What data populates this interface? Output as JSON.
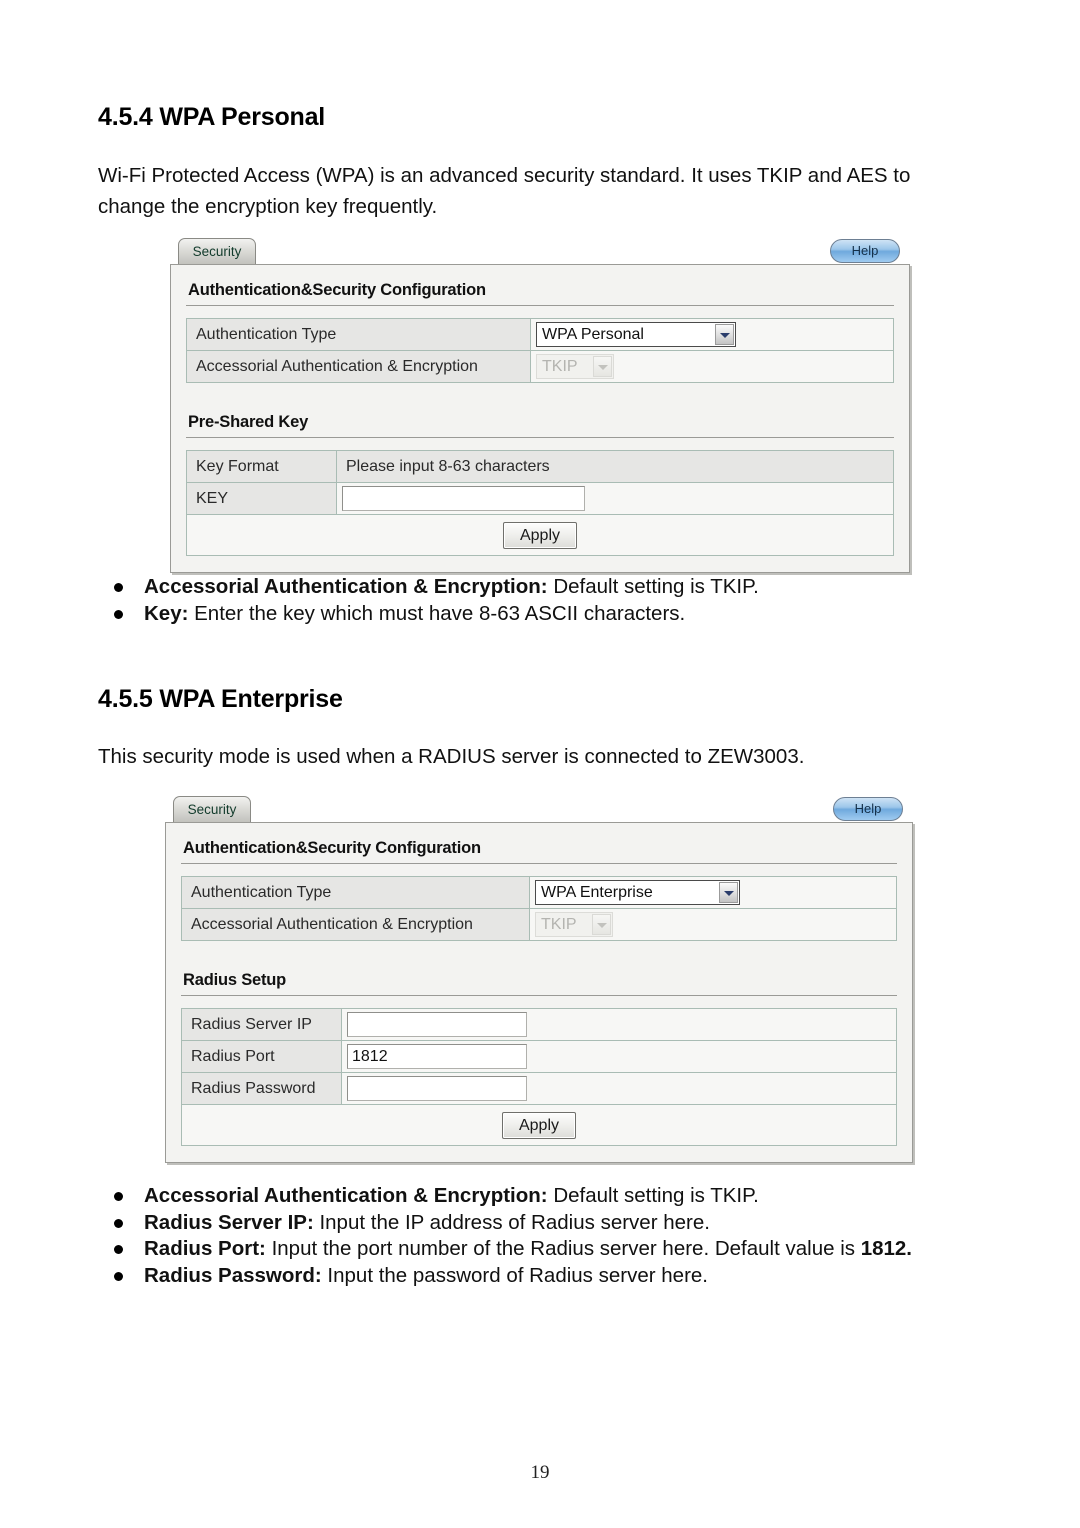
{
  "document": {
    "section_1": {
      "heading": "4.5.4 WPA Personal",
      "paragraph": "Wi-Fi Protected Access (WPA) is an advanced security standard. It uses TKIP and AES to change the encryption key frequently.",
      "bullets": [
        {
          "term": "Accessorial Authentication & Encryption:",
          "text": " Default setting is TKIP."
        },
        {
          "term": "Key:",
          "text": " Enter the key which must have 8-63 ASCII characters."
        }
      ]
    },
    "section_2": {
      "heading": "4.5.5 WPA Enterprise",
      "paragraph": "This security mode is used when a RADIUS server is connected to ZEW3003.",
      "bullets": [
        {
          "term": "Accessorial Authentication & Encryption:",
          "text": " Default setting is TKIP."
        },
        {
          "term": "Radius Server IP:",
          "text": " Input the IP address of Radius server here."
        },
        {
          "term": "Radius Port:",
          "text": " Input the port number of the Radius server here. Default value is ",
          "trailing_bold": "1812."
        },
        {
          "term": "Radius Password:",
          "text": "  Input the password of Radius server here."
        }
      ]
    },
    "page_number": "19"
  },
  "screenshot_wpa_personal": {
    "tab_label": "Security",
    "help_label": "Help",
    "section_title": "Authentication&Security Configuration",
    "rows": [
      {
        "label": "Authentication Type",
        "control": "select",
        "value": "WPA Personal",
        "disabled": false
      },
      {
        "label": "Accessorial Authentication & Encryption",
        "control": "select",
        "value": "TKIP",
        "disabled": true
      }
    ],
    "subsection_title": "Pre-Shared Key",
    "key_rows": [
      {
        "label": "Key Format",
        "control": "text-static",
        "value": "Please input 8-63 characters"
      },
      {
        "label": "KEY",
        "control": "input",
        "value": ""
      }
    ],
    "apply_label": "Apply"
  },
  "screenshot_wpa_enterprise": {
    "tab_label": "Security",
    "help_label": "Help",
    "section_title": "Authentication&Security Configuration",
    "rows": [
      {
        "label": "Authentication Type",
        "control": "select",
        "value": "WPA Enterprise",
        "disabled": false
      },
      {
        "label": "Accessorial Authentication & Encryption",
        "control": "select",
        "value": "TKIP",
        "disabled": true
      }
    ],
    "subsection_title": "Radius Setup",
    "radius_rows": [
      {
        "label": "Radius Server IP",
        "control": "input",
        "value": ""
      },
      {
        "label": "Radius Port",
        "control": "input",
        "value": "1812"
      },
      {
        "label": "Radius Password",
        "control": "input",
        "value": ""
      }
    ],
    "apply_label": "Apply"
  },
  "colors": {
    "tab_text": "#123b2c",
    "help_blue": "#6fa9dd",
    "panel_bg": "#f3f3f1",
    "label_cell": "#e6e6e4",
    "cell_border": "#a9bcb4"
  }
}
